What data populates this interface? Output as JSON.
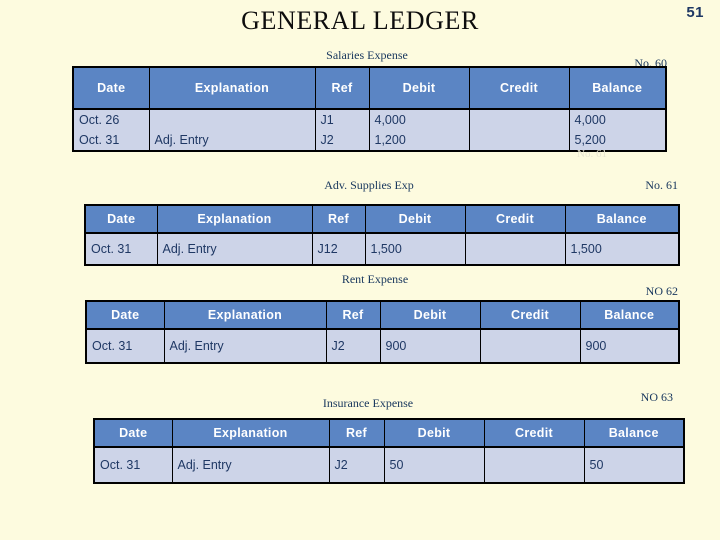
{
  "page": {
    "number": "51",
    "title": "GENERAL LEDGER",
    "background_color": "#fdfbdf",
    "header_color": "#5b85c4",
    "cell_color": "#cdd4e8",
    "text_color": "#1f3864"
  },
  "columns": [
    "Date",
    "Explanation",
    "Ref",
    "Debit",
    "Credit",
    "Balance"
  ],
  "ledgers": [
    {
      "account": "Salaries Expense",
      "number": "No. 60",
      "columns": [
        "Date",
        "Explanation",
        "Ref",
        "Debit",
        "Credit",
        "Balance"
      ],
      "rows": [
        {
          "date": "Oct. 26",
          "explanation": "",
          "ref": "J1",
          "debit": "4,000",
          "credit": "",
          "balance": "4,000"
        },
        {
          "date": "Oct.  31",
          "explanation": "Adj. Entry",
          "ref": "J2",
          "debit": "1,200",
          "credit": "",
          "balance": "5,200"
        }
      ]
    },
    {
      "account": "Adv. Supplies Exp",
      "number": "No. 61",
      "columns": [
        "Date",
        "Explanation",
        "Ref",
        "Debit",
        "Credit",
        "Balance"
      ],
      "rows": [
        {
          "date": "Oct. 31",
          "explanation": "Adj. Entry",
          "ref": "J12",
          "debit": "1,500",
          "credit": "",
          "balance": "1,500"
        }
      ]
    },
    {
      "account": "Rent Expense",
      "number": "NO 62",
      "columns": [
        "Date",
        "Explanation",
        "Ref",
        "Debit",
        "Credit",
        "Balance"
      ],
      "rows": [
        {
          "date": "Oct. 31",
          "explanation": "Adj. Entry",
          "ref": "J2",
          "debit": "900",
          "credit": "",
          "balance": "900"
        }
      ]
    },
    {
      "account": "Insurance Expense",
      "number": "NO 63",
      "columns": [
        "Date",
        "Explanation",
        "Ref",
        "Debit",
        "Credit",
        "Balance"
      ],
      "rows": [
        {
          "date": "Oct. 31",
          "explanation": "Adj. Entry",
          "ref": "J2",
          "debit": "50",
          "credit": "",
          "balance": "50"
        }
      ]
    }
  ],
  "artifact": {
    "clipped_text": "No. 61"
  }
}
